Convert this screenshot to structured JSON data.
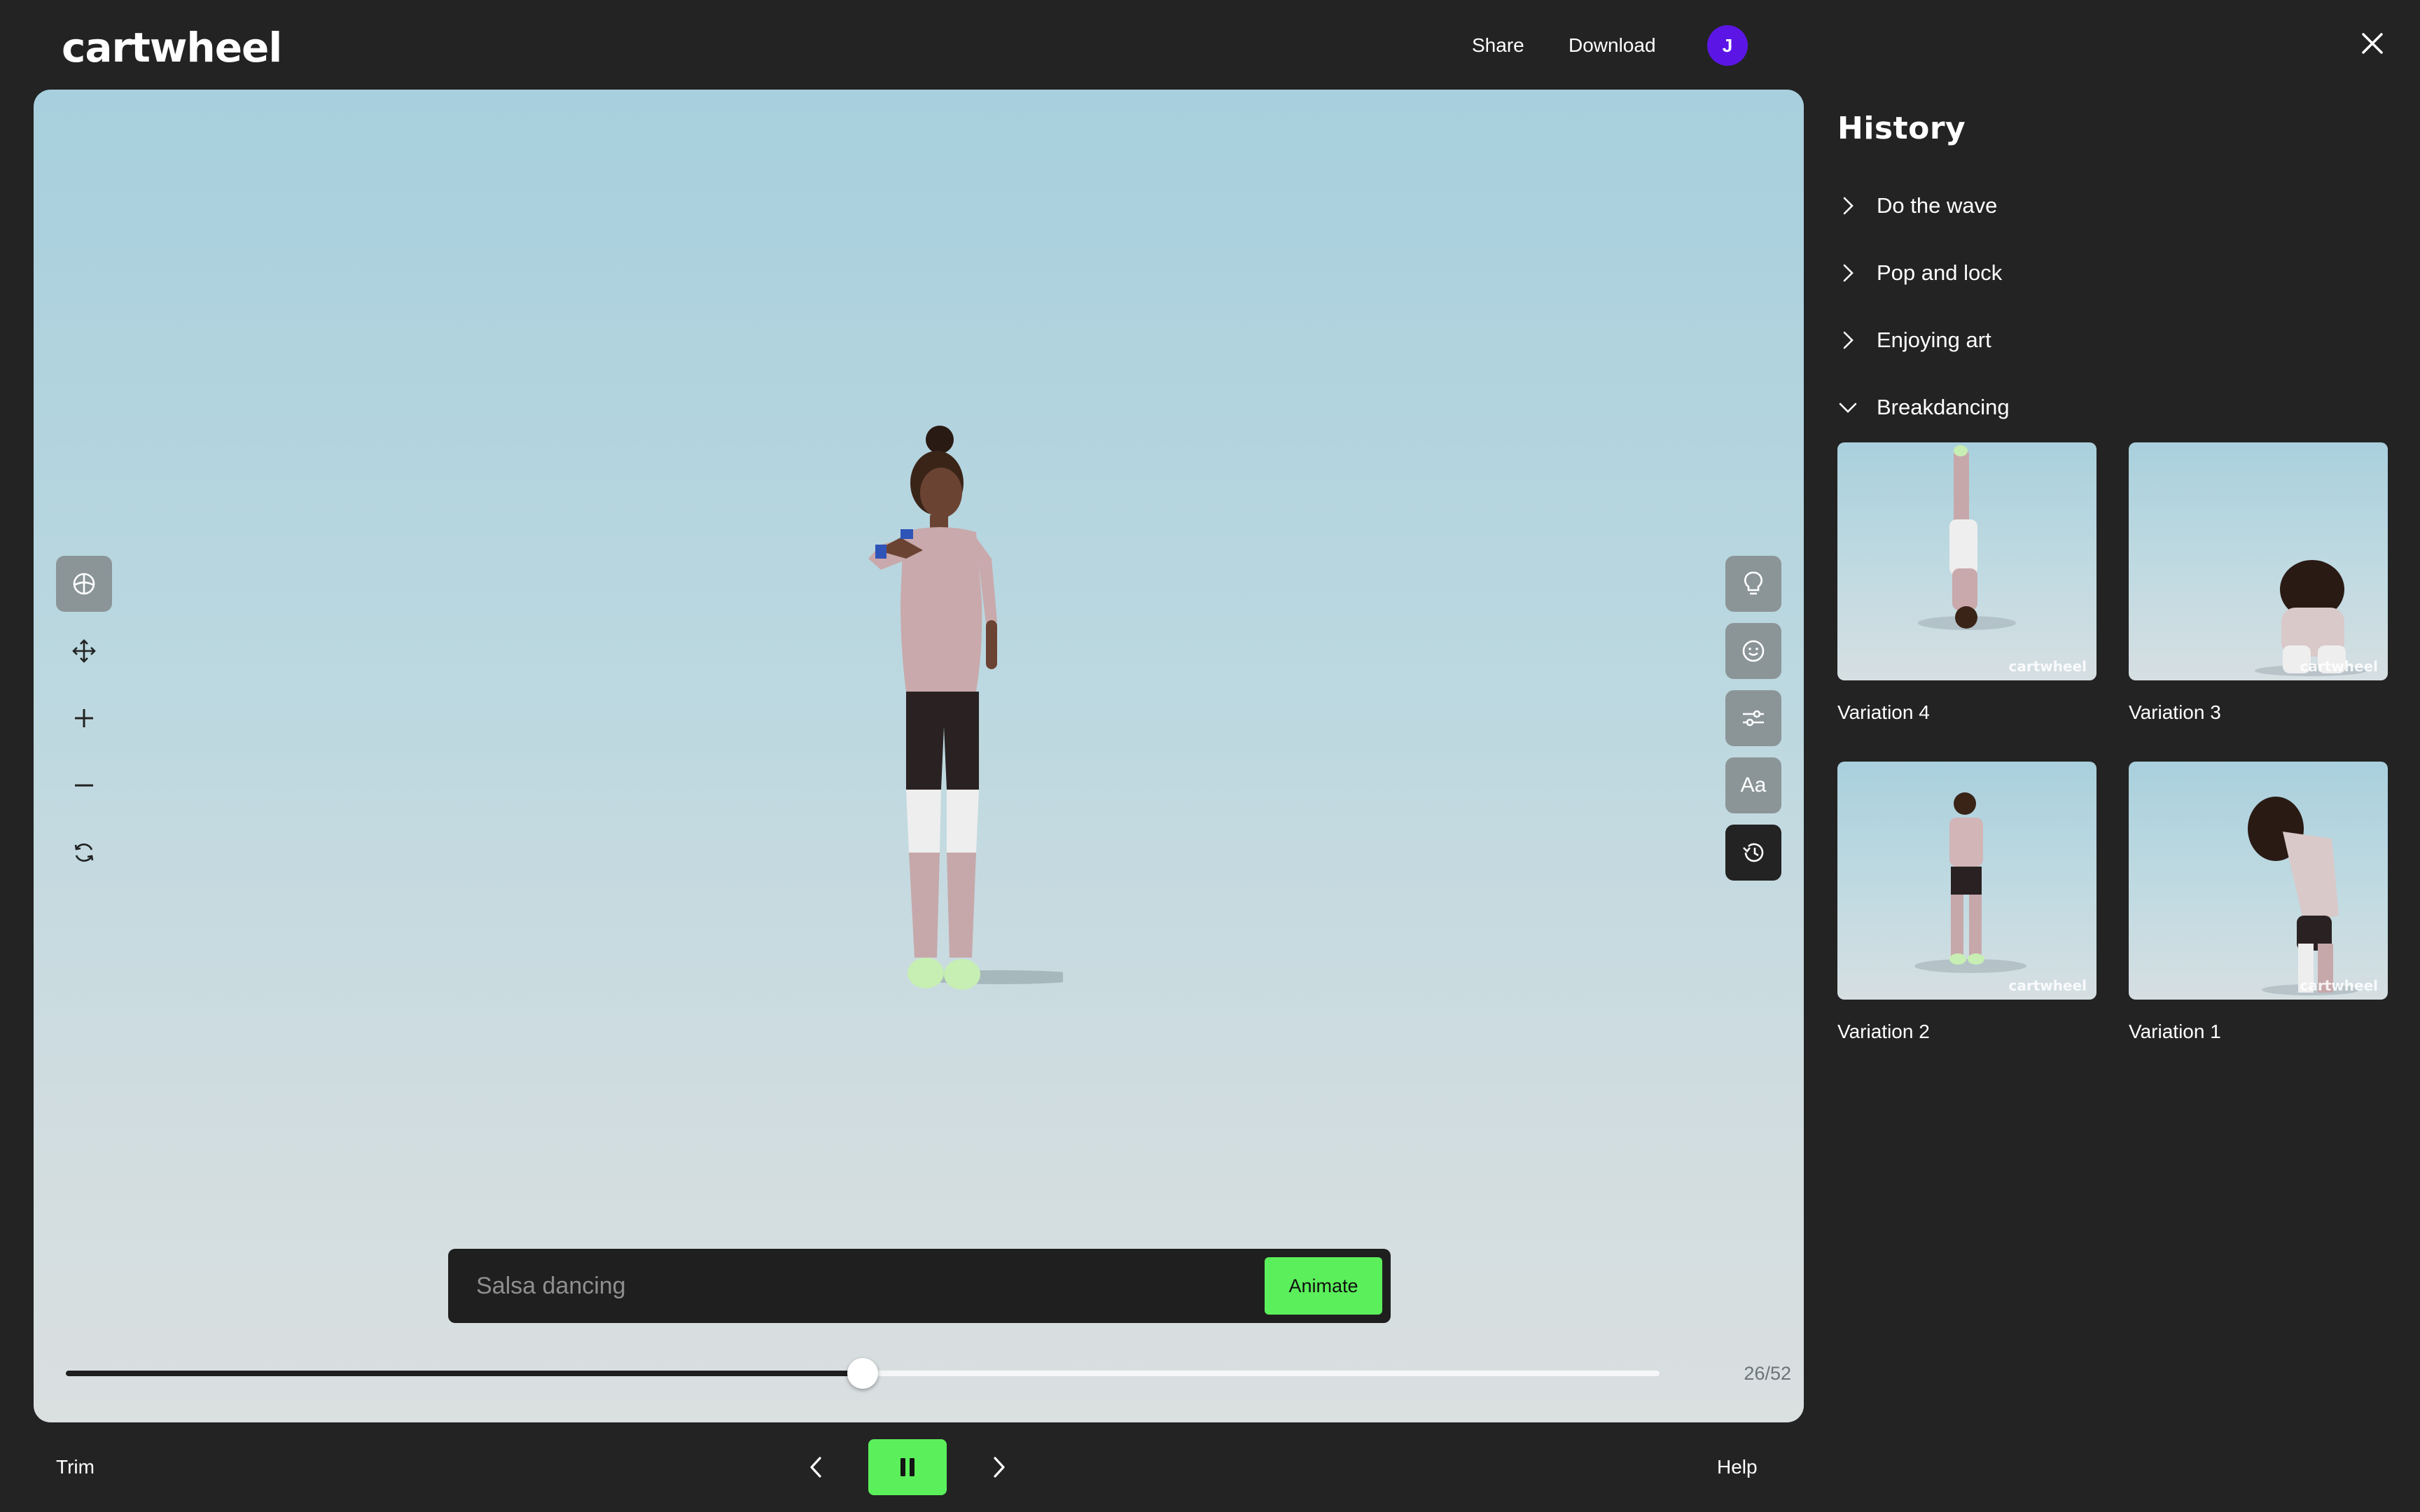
{
  "header": {
    "logo": "cartwheel",
    "share_label": "Share",
    "download_label": "Download",
    "avatar_initial": "J"
  },
  "viewport": {
    "left_tools": [
      "globe-icon",
      "move-icon",
      "zoom-in-icon",
      "zoom-out-icon",
      "reset-view-icon"
    ],
    "right_tools": [
      "lightbulb-icon",
      "emoji-icon",
      "sliders-icon",
      "text-icon",
      "history-icon"
    ],
    "text_tool_label": "Aa",
    "prompt": {
      "placeholder": "Salsa dancing",
      "value": ""
    },
    "animate_label": "Animate",
    "timeline": {
      "current_frame": 26,
      "total_frames": 52,
      "label": "26/52"
    }
  },
  "bottom_bar": {
    "trim_label": "Trim",
    "help_label": "Help",
    "playing": true
  },
  "history": {
    "title": "History",
    "items": [
      {
        "label": "Do the wave",
        "expanded": false
      },
      {
        "label": "Pop and lock",
        "expanded": false
      },
      {
        "label": "Enjoying art",
        "expanded": false
      },
      {
        "label": "Breakdancing",
        "expanded": true
      }
    ],
    "variations": [
      {
        "label": "Variation 4"
      },
      {
        "label": "Variation 3"
      },
      {
        "label": "Variation 2"
      },
      {
        "label": "Variation 1"
      }
    ],
    "watermark": "cartwheel"
  },
  "colors": {
    "accent_green": "#5bf05b",
    "avatar_purple": "#5b16e6",
    "background": "#232323"
  }
}
